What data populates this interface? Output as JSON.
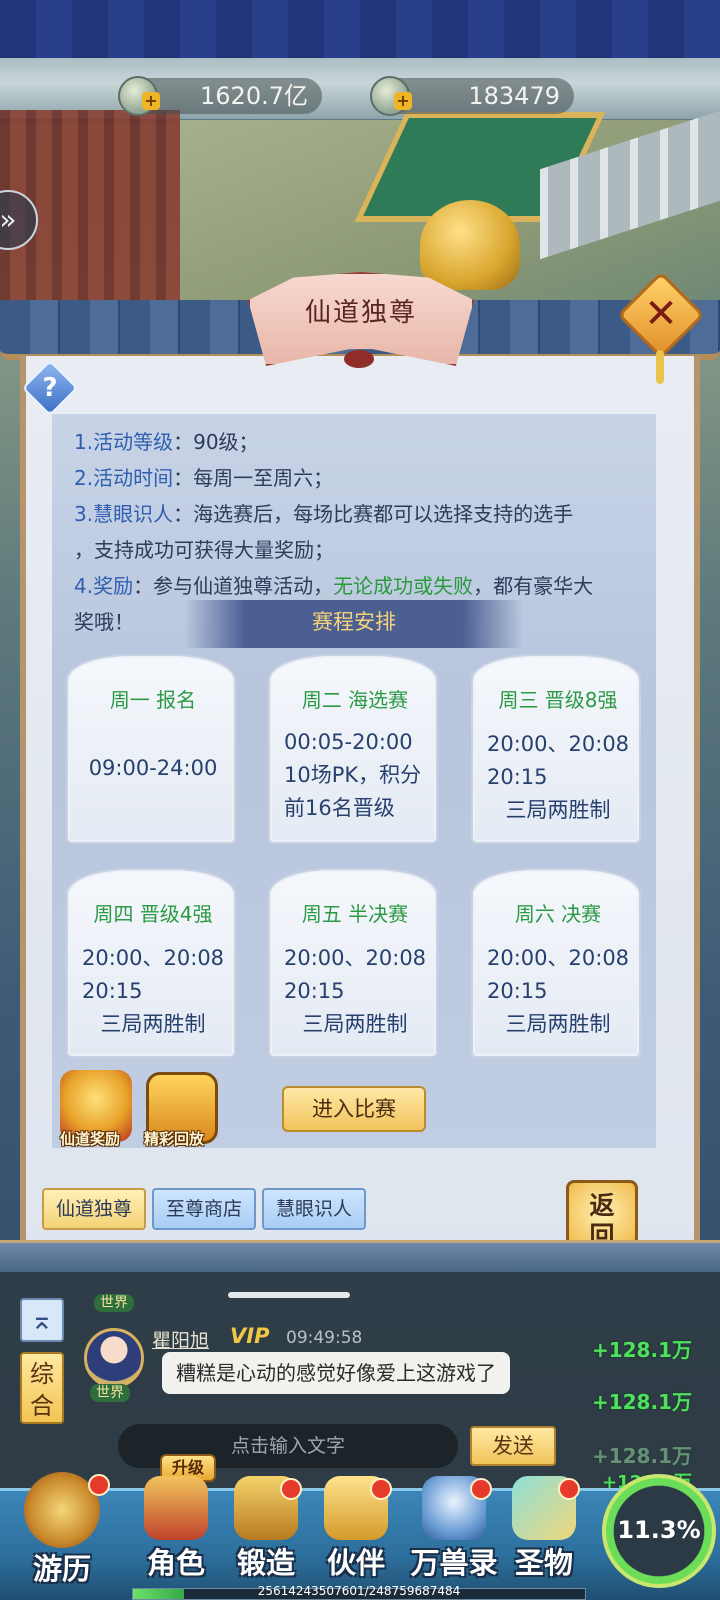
{
  "currency": {
    "gold": "1620.7亿",
    "jade": "183479"
  },
  "panel": {
    "title": "仙道独尊",
    "rules": {
      "line1_num": "1.",
      "line1_label": "活动等级",
      "line1_val": "：90级；",
      "line2_num": "2.",
      "line2_label": "活动时间",
      "line2_val": "：每周一至周六；",
      "line3_num": "3.",
      "line3_label": "慧眼识人",
      "line3_val": "：海选赛后，每场比赛都可以选择支持的选手",
      "line3b": "，支持成功可获得大量奖励；",
      "line4_num": "4.",
      "line4_label": "奖励",
      "line4_val": "：参与仙道独尊活动，",
      "line4_hl": "无论成功或失败",
      "line4_tail": "，都有豪华大",
      "line4b": "奖哦！"
    },
    "schedule_title": "赛程安排",
    "schedule": [
      {
        "head": "周一 报名",
        "lines": [
          "09:00-24:00"
        ]
      },
      {
        "head": "周二 海选赛",
        "lines": [
          "00:05-20:00",
          "10场PK，积分",
          "前16名晋级"
        ]
      },
      {
        "head": "周三 晋级8强",
        "lines": [
          "20:00、20:08",
          "20:15",
          "三局两胜制"
        ]
      },
      {
        "head": "周四 晋级4强",
        "lines": [
          "20:00、20:08",
          "20:15",
          "三局两胜制"
        ]
      },
      {
        "head": "周五 半决赛",
        "lines": [
          "20:00、20:08",
          "20:15",
          "三局两胜制"
        ]
      },
      {
        "head": "周六 决赛",
        "lines": [
          "20:00、20:08",
          "20:15",
          "三局两胜制"
        ]
      }
    ],
    "reward_label": "仙道奖励",
    "replay_label": "精彩回放",
    "enter_label": "进入比赛",
    "tabs": [
      "仙道独尊",
      "至尊商店",
      "慧眼识人"
    ],
    "back_label": "返回"
  },
  "chat": {
    "world_tag": "世界",
    "mix_label": "综合",
    "username": "瞿阳旭",
    "vip": "VIP",
    "time": "09:49:58",
    "message": "糟糕是心动的感觉好像爱上这游戏了",
    "gains": [
      "+128.1万",
      "+128.1万",
      "+128.1万",
      "+128.1万"
    ],
    "input_placeholder": "点击输入文字",
    "send_label": "发送"
  },
  "nav": {
    "items": [
      "游历",
      "角色",
      "锻造",
      "伙伴",
      "万兽录",
      "圣物"
    ],
    "upgrade_badge": "升级",
    "exp_text": "25614243507601/248759687484",
    "exp_fraction": 0.113,
    "percent": "11.3%"
  },
  "colors": {
    "accent_green": "#2c9a45",
    "gain_green": "#4ee05e",
    "gold": "#f2c744"
  },
  "icons": [
    "gold-coin-icon",
    "jade-fish-icon",
    "help-icon",
    "close-icon",
    "expand-arrow-icon",
    "collapse-up-icon"
  ]
}
